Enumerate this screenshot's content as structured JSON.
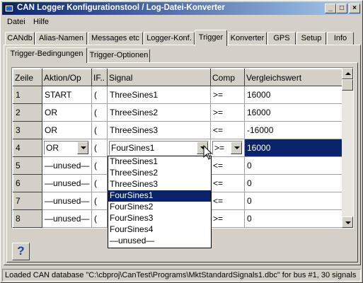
{
  "window": {
    "title": "CAN Logger Konfigurationstool / Log-Datei-Konverter",
    "minimize": "_",
    "maximize": "□",
    "close": "×"
  },
  "menu": [
    "Datei",
    "Hilfe"
  ],
  "tabs": [
    "CANdb",
    "Alias-Namen",
    "Messages etc",
    "Logger-Konf.",
    "Trigger",
    "Konverter",
    "GPS",
    "Setup",
    "Info"
  ],
  "active_tab": "Trigger",
  "subtabs": [
    "Trigger-Bedingungen",
    "Trigger-Optionen"
  ],
  "active_subtab": "Trigger-Bedingungen",
  "grid": {
    "headers": [
      "Zeile",
      "Aktion/Op",
      "IF..",
      "Signal",
      "Comp",
      "Vergleichswert"
    ],
    "rows": [
      {
        "zeile": "1",
        "aktion": "START",
        "if": "(",
        "signal": "ThreeSines1",
        "comp": ">=",
        "wert": "16000"
      },
      {
        "zeile": "2",
        "aktion": "OR",
        "if": "(",
        "signal": "ThreeSines2",
        "comp": ">=",
        "wert": "16000"
      },
      {
        "zeile": "3",
        "aktion": "OR",
        "if": "(",
        "signal": "ThreeSines3",
        "comp": "<=",
        "wert": "-16000"
      },
      {
        "zeile": "4",
        "aktion": "OR",
        "if": "(",
        "signal": "FourSines1",
        "comp": ">=",
        "wert": "16000"
      },
      {
        "zeile": "5",
        "aktion": "—unused—",
        "if": "(",
        "signal": "",
        "comp": "<=",
        "wert": "0"
      },
      {
        "zeile": "6",
        "aktion": "—unused—",
        "if": "(",
        "signal": "",
        "comp": "<=",
        "wert": "0"
      },
      {
        "zeile": "7",
        "aktion": "—unused—",
        "if": "(",
        "signal": "",
        "comp": "<=",
        "wert": "0"
      },
      {
        "zeile": "8",
        "aktion": "—unused—",
        "if": "(",
        "signal": "",
        "comp": ">=",
        "wert": "0"
      }
    ]
  },
  "signal_dropdown": {
    "options": [
      "ThreeSines1",
      "ThreeSines2",
      "ThreeSines3",
      "FourSines1",
      "FourSines2",
      "FourSines3",
      "FourSines4",
      "—unused—"
    ],
    "highlighted": "FourSines1"
  },
  "help_button": "?",
  "status": "Loaded CAN database \"C:\\cbproj\\CanTest\\Programs\\MktStandardSignals1.dbc\" for bus #1, 30 signals",
  "colors": {
    "selection": "#0a246a",
    "face": "#d4d0c8",
    "title_start": "#0a246a",
    "title_end": "#a6caf0"
  }
}
